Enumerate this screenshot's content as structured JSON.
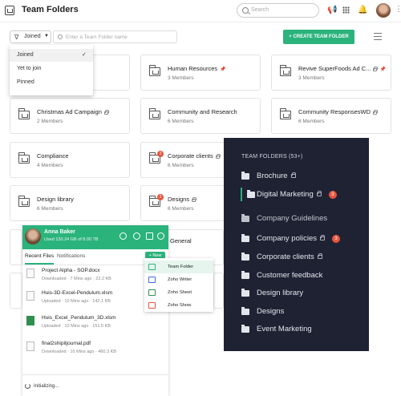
{
  "header": {
    "title": "Team Folders",
    "search_placeholder": "Search",
    "icons": [
      "app-logo-icon",
      "megaphone-icon",
      "apps-grid-icon",
      "bell-icon",
      "avatar",
      "more-vertical-icon"
    ]
  },
  "toolbar": {
    "filter_label": "Joined",
    "search_placeholder": "Enter a Team Folder name",
    "create_label": "+ CREATE TEAM FOLDER"
  },
  "filter_menu": {
    "items": [
      "Joined",
      "Yet to join",
      "Pinned"
    ],
    "selected": "Joined"
  },
  "cards": [
    {
      "name": "Human Resources",
      "meta": "3 Members",
      "pinned": true
    },
    {
      "name": "Revive SuperFoods Ad C...",
      "meta": "3 Members",
      "locked": true,
      "pinned": true
    },
    {
      "name": "Christmas Ad Campaign",
      "meta": "2 Members",
      "locked": true
    },
    {
      "name": "Community and Research",
      "meta": "6 Members"
    },
    {
      "name": "Community ResponsesWD",
      "meta": "6 Members",
      "locked": true
    },
    {
      "name": "Compliance",
      "meta": "4 Members"
    },
    {
      "name": "Corporate clients",
      "meta": "6 Members",
      "locked": true,
      "badge": "3"
    },
    {
      "name": "Design library",
      "meta": "6 Members"
    },
    {
      "name": "Designs",
      "meta": "6 Members",
      "locked": true,
      "badge": "3"
    },
    {
      "name": "General",
      "meta": ""
    }
  ],
  "dark_panel": {
    "title": "TEAM FOLDERS (53+)",
    "items": [
      {
        "label": "Brochure",
        "locked": true
      },
      {
        "label": "Digital Marketing",
        "locked": true,
        "badge": "3",
        "active": true
      },
      {
        "label": "Company Guidelines"
      },
      {
        "label": "Company policies",
        "locked": true,
        "badge": "3"
      },
      {
        "label": "Corporate clients",
        "locked": true
      },
      {
        "label": "Customer feedback"
      },
      {
        "label": "Design library"
      },
      {
        "label": "Designs"
      },
      {
        "label": "Event Marketing"
      }
    ]
  },
  "mobile": {
    "user_name": "Anna Baker",
    "usage": "Used 130.24 GB of 8.00 TB",
    "tabs": [
      "Recent Files",
      "Notifications"
    ],
    "new_label": "+ New",
    "files": [
      {
        "name": "Project Alpha - SOP.docx",
        "meta": "Downloaded  ·  7 Mins ago  ·  22.2 KB"
      },
      {
        "name": "Huis-3D-Excel-Pendulum.xlsm",
        "meta": "Uploaded  ·  10 Mins ago  ·  142.1 KB"
      },
      {
        "name": "Huis_Excel_Pendulum_3D.xlsm",
        "meta": "Uploaded  ·  10 Mins ago  ·  151.5 KB"
      },
      {
        "name": "final2shipitjournal.pdf",
        "meta": "Downloaded  ·  10 Mins ago  ·  460.3 KB"
      }
    ],
    "status": "Initializing..."
  },
  "new_menu": {
    "items": [
      "Team Folder",
      "Zoho Writer",
      "Zoho Sheet",
      "Zoho Show"
    ]
  },
  "colors": {
    "accent": "#2bb37c",
    "dark_panel_bg": "#1f2233",
    "badge": "#e8553e"
  }
}
